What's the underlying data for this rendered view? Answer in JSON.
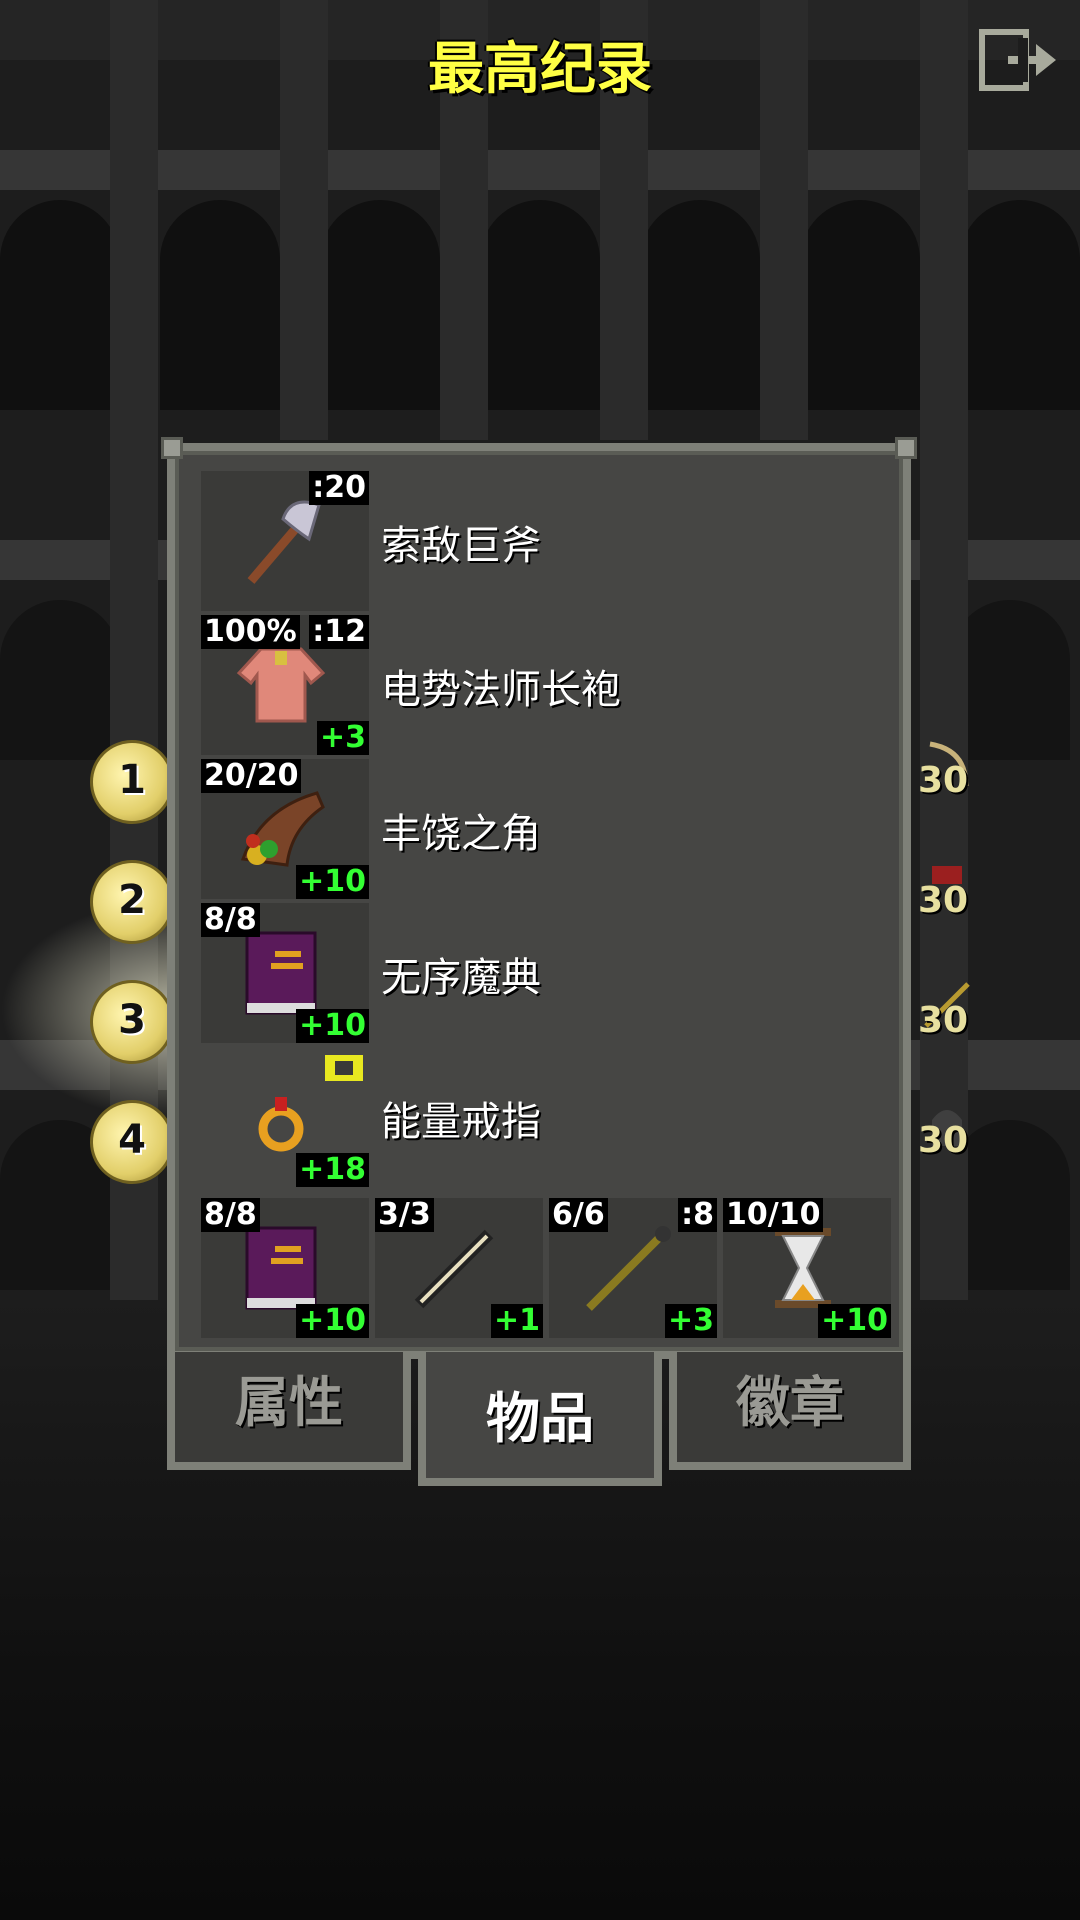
{
  "title": "最高纪录",
  "rank_coins": [
    "1",
    "2",
    "3",
    "4"
  ],
  "scores": [
    "30",
    "30",
    "30",
    "30"
  ],
  "items": [
    {
      "name": "索敌巨斧",
      "top_left": "",
      "top_right": ":20",
      "bottom_right": "",
      "icon": "axe-icon"
    },
    {
      "name": "电势法师长袍",
      "top_left": "100%",
      "top_right": ":12",
      "bottom_right": "+3",
      "icon": "robe-icon"
    },
    {
      "name": "丰饶之角",
      "top_left": "20/20",
      "top_right": "",
      "bottom_right": "+10",
      "icon": "horn-of-plenty-icon"
    },
    {
      "name": "无序魔典",
      "top_left": "8/8",
      "top_right": "",
      "bottom_right": "+10",
      "icon": "spellbook-icon"
    },
    {
      "name": "能量戒指",
      "top_left": "",
      "top_right": "",
      "bottom_right": "+18",
      "icon": "ring-icon"
    }
  ],
  "quickslots": [
    {
      "top_left": "8/8",
      "top_right": "",
      "bottom_right": "+10",
      "icon": "spellbook-icon"
    },
    {
      "top_left": "3/3",
      "top_right": "",
      "bottom_right": "+1",
      "icon": "wand-icon"
    },
    {
      "top_left": "6/6",
      "top_right": ":8",
      "bottom_right": "+3",
      "icon": "staff-icon"
    },
    {
      "top_left": "10/10",
      "top_right": "",
      "bottom_right": "+10",
      "icon": "hourglass-icon"
    }
  ],
  "tabs": [
    {
      "label": "属性",
      "active": false
    },
    {
      "label": "物品",
      "active": true
    },
    {
      "label": "徽章",
      "active": false
    }
  ],
  "colors": {
    "title": "#ffff44",
    "upgrade": "#33ff33",
    "panel": "#464644",
    "frame": "#7e8078"
  }
}
